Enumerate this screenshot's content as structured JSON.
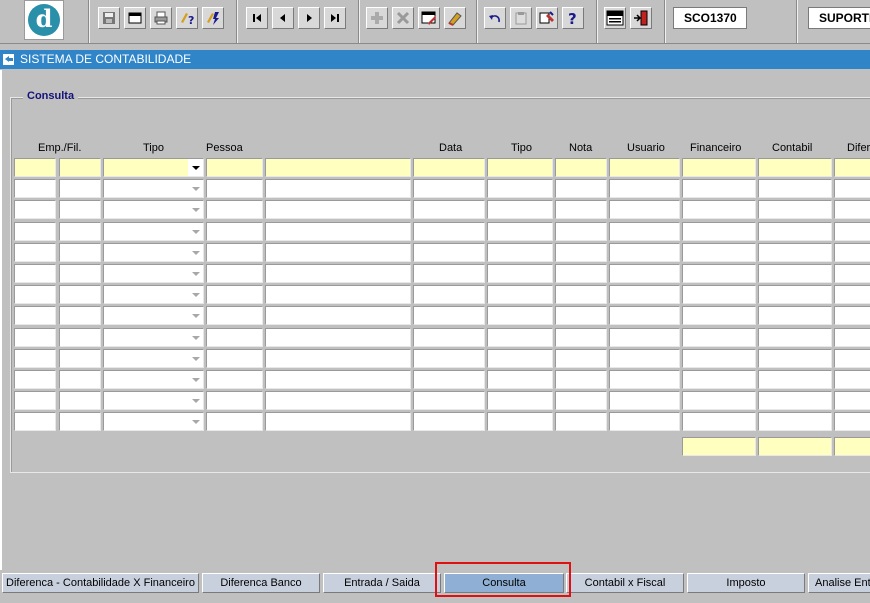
{
  "toolbar": {
    "logo_letter": "d",
    "icons": [
      "save-icon",
      "window-icon",
      "print-icon",
      "query-help-icon",
      "execute-query-icon",
      "first-record-icon",
      "previous-record-icon",
      "next-record-icon",
      "last-record-icon",
      "insert-record-icon",
      "delete-record-icon",
      "edit-icon",
      "clear-icon",
      "undo-icon",
      "clipboard-icon",
      "tools-icon",
      "help-icon",
      "menu-icon",
      "exit-icon"
    ],
    "screen_code": "SCO1370",
    "user": "SUPORTE"
  },
  "window": {
    "title": "SISTEMA DE CONTABILIDADE"
  },
  "consulta": {
    "group_label": "Consulta",
    "columns": [
      "Emp./Fil.",
      "Tipo",
      "Pessoa",
      "Data",
      "Tipo",
      "Nota",
      "Usuario",
      "Financeiro",
      "Contabil",
      "Diferenca"
    ],
    "row_count": 13,
    "colors": {
      "highlight": "#ffffc0",
      "field": "#ffffff"
    }
  },
  "tabs": {
    "items": [
      "Diferenca - Contabilidade X Financeiro",
      "Diferenca Banco",
      "Entrada / Saida",
      "Consulta",
      "Contabil x Fiscal",
      "Imposto",
      "Analise Entrada"
    ],
    "active": "Consulta"
  },
  "colors": {
    "title_bar": "#2f85c8",
    "active_tab": "#8fb0d4",
    "highlight_box": "#e01010"
  }
}
